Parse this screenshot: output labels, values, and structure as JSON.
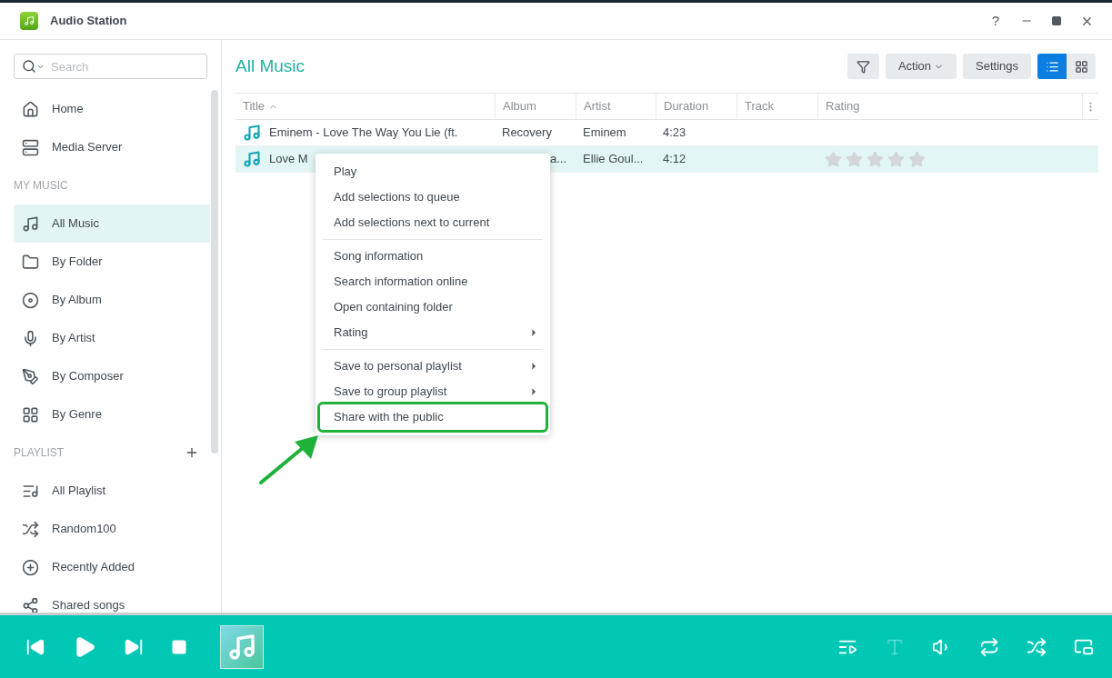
{
  "window": {
    "title": "Audio Station",
    "help": "?"
  },
  "search": {
    "placeholder": "Search"
  },
  "sidebar": {
    "items": [
      {
        "kind": "item",
        "label": "Home",
        "selected": false
      },
      {
        "kind": "item",
        "label": "Media Server",
        "selected": false
      },
      {
        "kind": "heading",
        "label": "MY MUSIC"
      },
      {
        "kind": "item",
        "label": "All Music",
        "selected": true
      },
      {
        "kind": "item",
        "label": "By Folder",
        "selected": false
      },
      {
        "kind": "item",
        "label": "By Album",
        "selected": false
      },
      {
        "kind": "item",
        "label": "By Artist",
        "selected": false
      },
      {
        "kind": "item",
        "label": "By Composer",
        "selected": false
      },
      {
        "kind": "item",
        "label": "By Genre",
        "selected": false
      },
      {
        "kind": "heading",
        "label": "PLAYLIST",
        "add": true
      },
      {
        "kind": "item",
        "label": "All Playlist",
        "selected": false
      },
      {
        "kind": "item",
        "label": "Random100",
        "selected": false
      },
      {
        "kind": "item",
        "label": "Recently Added",
        "selected": false
      },
      {
        "kind": "item",
        "label": "Shared songs",
        "selected": false
      }
    ]
  },
  "main": {
    "title": "All Music",
    "buttons": [
      {
        "kind": "icon"
      },
      {
        "kind": "dropdown",
        "label": "Action"
      },
      {
        "kind": "text",
        "label": "Settings"
      }
    ],
    "view_modes": [
      {
        "selected": true
      },
      {
        "selected": false
      }
    ]
  },
  "table": {
    "columns": [
      {
        "label": "Title",
        "sorted": true
      },
      {
        "label": "Album"
      },
      {
        "label": "Artist"
      },
      {
        "label": "Duration"
      },
      {
        "label": "Track"
      },
      {
        "label": "Rating"
      }
    ],
    "rows": [
      {
        "title": "Eminem - Love The Way You Lie (ft.",
        "album": "Recovery",
        "artist": "Eminem",
        "duration": "4:23",
        "selected": false
      },
      {
        "title": "Love M",
        "album": "a...",
        "artist": "Ellie Goul...",
        "duration": "4:12",
        "selected": true,
        "stars": 0
      }
    ]
  },
  "context_menu": {
    "groups": [
      [
        {
          "label": "Play"
        },
        {
          "label": "Add selections to queue"
        },
        {
          "label": "Add selections next to current"
        }
      ],
      [
        {
          "label": "Song information"
        },
        {
          "label": "Search information online"
        },
        {
          "label": "Open containing folder"
        },
        {
          "label": "Rating",
          "submenu": true
        }
      ],
      [
        {
          "label": "Save to personal playlist",
          "submenu": true
        },
        {
          "label": "Save to group playlist",
          "submenu": true
        },
        {
          "label": "Share with the public",
          "highlighted": true
        }
      ]
    ]
  },
  "player": {
    "tools": [
      {
        "disabled": false
      },
      {
        "disabled": true
      },
      {
        "disabled": false
      },
      {
        "disabled": false
      },
      {
        "disabled": false
      },
      {
        "disabled": false
      }
    ]
  }
}
